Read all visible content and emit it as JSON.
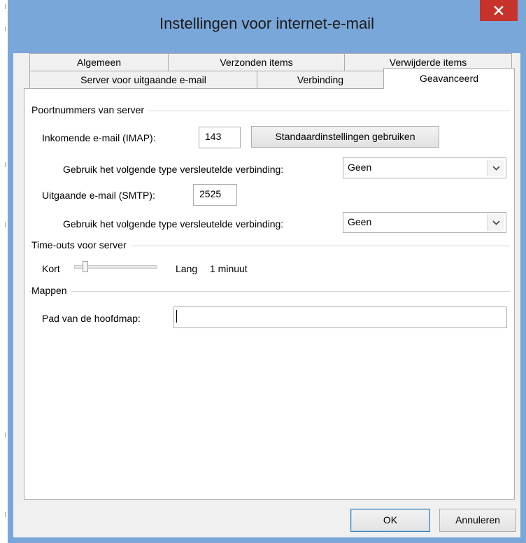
{
  "window": {
    "title": "Instellingen voor internet-e-mail",
    "close_icon": "close-icon"
  },
  "tabs": {
    "row1": [
      {
        "label": "Algemeen"
      },
      {
        "label": "Verzonden items"
      },
      {
        "label": "Verwijderde items"
      }
    ],
    "row2": [
      {
        "label": "Server voor uitgaande e-mail"
      },
      {
        "label": "Verbinding"
      },
      {
        "label": "Geavanceerd",
        "selected": true
      }
    ]
  },
  "ports": {
    "group_label": "Poortnummers van server",
    "incoming_label": "Inkomende e-mail (IMAP):",
    "incoming_value": "143",
    "defaults_button": "Standaardinstellingen gebruiken",
    "incoming_encryption_label": "Gebruik het volgende type versleutelde verbinding:",
    "incoming_encryption_value": "Geen",
    "outgoing_label": "Uitgaande e-mail (SMTP):",
    "outgoing_value": "2525",
    "outgoing_encryption_label": "Gebruik het volgende type versleutelde verbinding:",
    "outgoing_encryption_value": "Geen"
  },
  "timeouts": {
    "group_label": "Time-outs voor server",
    "short_label": "Kort",
    "long_label": "Lang",
    "value_text": "1 minuut",
    "slider_position": 0.1
  },
  "folders": {
    "group_label": "Mappen",
    "root_path_label": "Pad van de hoofdmap:",
    "root_path_value": ""
  },
  "footer": {
    "ok_label": "OK",
    "cancel_label": "Annuleren"
  },
  "colors": {
    "title_bar": "#7aa7d9",
    "close_button": "#c7322b",
    "dialog_background": "#f0f0f0"
  }
}
